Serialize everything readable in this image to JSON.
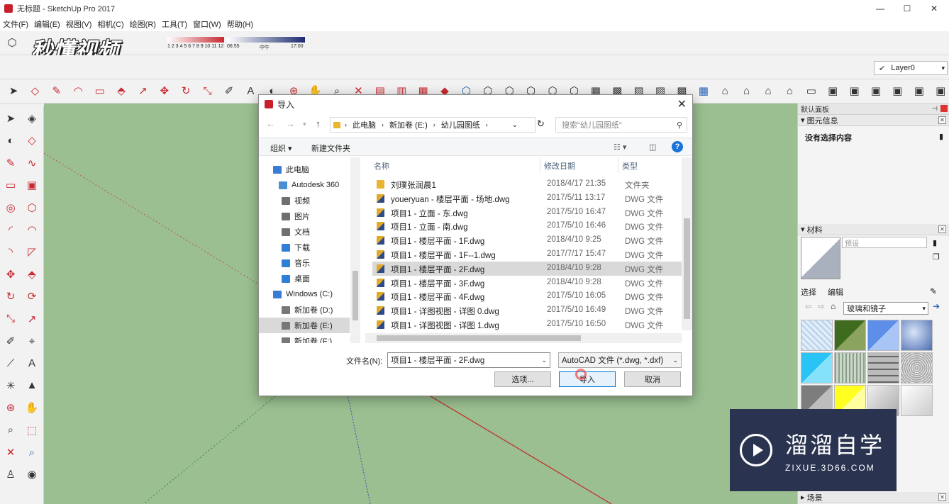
{
  "window": {
    "title": "无标题 - SketchUp Pro 2017",
    "minimize": "—",
    "maximize": "☐",
    "close": "✕"
  },
  "menu": [
    "文件(F)",
    "编辑(E)",
    "视图(V)",
    "相机(C)",
    "绘图(R)",
    "工具(T)",
    "窗口(W)",
    "帮助(H)"
  ],
  "watermark": "秒懂视频",
  "shadow_slider": {
    "months": "1 2 3 4 5 6 7 8 9 10 11 12",
    "time_start": "06:55",
    "time_mid": "中午",
    "time_end": "17:00"
  },
  "layer": {
    "current": "Layer0"
  },
  "tray": {
    "title": "默认面板",
    "entity_info": {
      "header": "图元信息",
      "text": "没有选择内容"
    },
    "materials": {
      "header": "材料",
      "name_placeholder": "预设",
      "tab_select": "选择",
      "tab_edit": "编辑",
      "library": "玻璃和镜子"
    },
    "scenes_header": "场景"
  },
  "brand": {
    "name": "溜溜自学",
    "url": "ZIXUE.3D66.COM"
  },
  "dialog": {
    "title": "导入",
    "breadcrumb": [
      "此电脑",
      "新加卷 (E:)",
      "幼儿园图纸"
    ],
    "search_placeholder": "搜索\"幼儿园图纸\"",
    "organize": "组织 ▾",
    "new_folder": "新建文件夹",
    "nav": [
      {
        "label": "此电脑",
        "color": "#3a7bd5"
      },
      {
        "label": "Autodesk 360",
        "color": "#4a8fd1"
      },
      {
        "label": "视频",
        "color": "#6f6f6f"
      },
      {
        "label": "图片",
        "color": "#6f6f6f"
      },
      {
        "label": "文档",
        "color": "#6f6f6f"
      },
      {
        "label": "下载",
        "color": "#2f7fd6"
      },
      {
        "label": "音乐",
        "color": "#2f7fd6"
      },
      {
        "label": "桌面",
        "color": "#2f7fd6"
      },
      {
        "label": "Windows (C:)",
        "color": "#3a7bd5"
      },
      {
        "label": "新加卷 (D:)",
        "color": "#777777"
      },
      {
        "label": "新加卷 (E:)",
        "color": "#777777"
      },
      {
        "label": "新加卷 (F:)",
        "color": "#777777"
      }
    ],
    "columns": {
      "name": "名称",
      "date": "修改日期",
      "type": "类型"
    },
    "files": [
      {
        "name": "刘璞张润晨1",
        "date": "2018/4/17 21:35",
        "type": "文件夹",
        "folder": true
      },
      {
        "name": "youeryuan - 楼层平面 - 场地.dwg",
        "date": "2017/5/11 13:17",
        "type": "DWG 文件"
      },
      {
        "name": "项目1 - 立面 - 东.dwg",
        "date": "2017/5/10 16:47",
        "type": "DWG 文件"
      },
      {
        "name": "项目1 - 立面 - 南.dwg",
        "date": "2017/5/10 16:46",
        "type": "DWG 文件"
      },
      {
        "name": "项目1 - 楼层平面 - 1F.dwg",
        "date": "2018/4/10 9:25",
        "type": "DWG 文件"
      },
      {
        "name": "项目1 - 楼层平面 - 1F--1.dwg",
        "date": "2017/7/17 15:47",
        "type": "DWG 文件"
      },
      {
        "name": "项目1 - 楼层平面 - 2F.dwg",
        "date": "2018/4/10 9:28",
        "type": "DWG 文件",
        "selected": true
      },
      {
        "name": "项目1 - 楼层平面 - 3F.dwg",
        "date": "2018/4/10 9:28",
        "type": "DWG 文件"
      },
      {
        "name": "项目1 - 楼层平面 - 4F.dwg",
        "date": "2017/5/10 16:05",
        "type": "DWG 文件"
      },
      {
        "name": "项目1 - 详图视图 - 详图 0.dwg",
        "date": "2017/5/10 16:49",
        "type": "DWG 文件"
      },
      {
        "name": "项目1 - 详图视图 - 详图 1.dwg",
        "date": "2017/5/10 16:50",
        "type": "DWG 文件"
      }
    ],
    "filename_label": "文件名(N):",
    "filename_value": "项目1 - 楼层平面 - 2F.dwg",
    "filetype": "AutoCAD 文件 (*.dwg, *.dxf)",
    "options_button": "选项...",
    "import_button": "导入",
    "cancel_button": "取消"
  },
  "colors": {
    "viewport": "#9bbf90",
    "brand_bg": "#2a3450",
    "selection": "#d9d9d9"
  }
}
